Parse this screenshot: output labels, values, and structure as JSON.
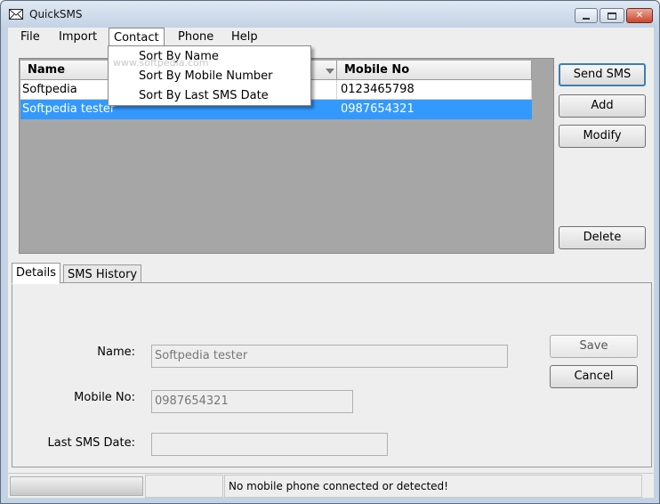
{
  "window": {
    "title": "QuickSMS"
  },
  "menubar": {
    "file": "File",
    "import": "Import",
    "contact": "Contact",
    "phone": "Phone",
    "help": "Help"
  },
  "contact_menu": [
    "Sort By Name",
    "Sort By Mobile Number",
    "Sort By Last SMS Date"
  ],
  "watermark": "www.softpedia.com",
  "table": {
    "headers": {
      "name": "Name",
      "mobile": "Mobile No"
    },
    "rows": [
      {
        "name": "Softpedia",
        "mobile": "0123465798",
        "selected": false
      },
      {
        "name": "Softpedia tester",
        "mobile": "0987654321",
        "selected": true
      }
    ]
  },
  "actions": {
    "send_sms": "Send SMS",
    "add": "Add",
    "modify": "Modify",
    "delete": "Delete"
  },
  "tabs": {
    "details": "Details",
    "sms_history": "SMS History",
    "active": "Details"
  },
  "details": {
    "name_label": "Name:",
    "name_value": "Softpedia tester",
    "mobile_label": "Mobile No:",
    "mobile_value": "0987654321",
    "last_sms_label": "Last SMS Date:",
    "last_sms_value": "",
    "save": "Save",
    "cancel": "Cancel"
  },
  "status": {
    "message": "No mobile phone connected or detected!"
  },
  "colors": {
    "selection": "#3399ff",
    "default_button_border": "#3c7fb1"
  },
  "icons": [
    "envelope-icon",
    "minimize-icon",
    "maximize-icon",
    "close-icon",
    "sort-down-icon"
  ]
}
